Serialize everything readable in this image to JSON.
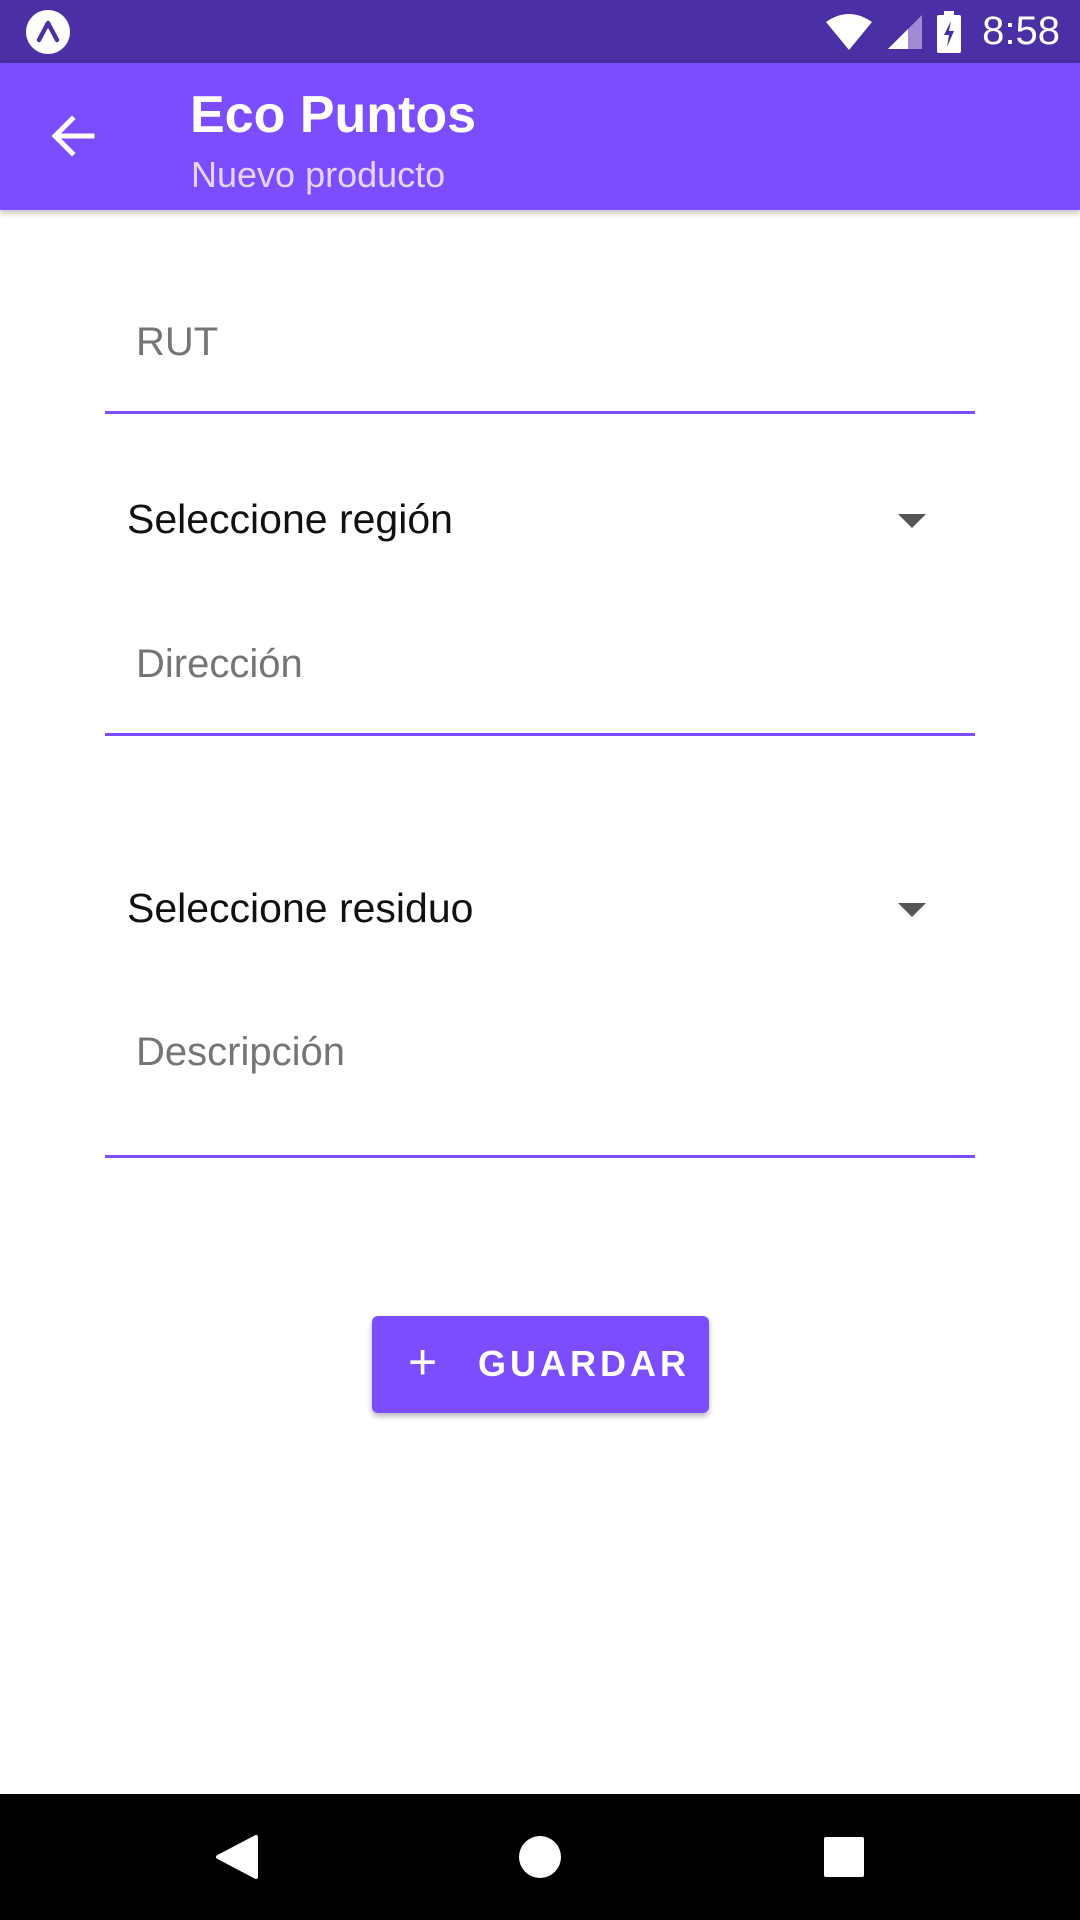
{
  "status_bar": {
    "time": "8:58",
    "app_icon": "expo-icon",
    "wifi_icon": "wifi-icon",
    "signal_icon": "cell-signal-icon",
    "battery_icon": "battery-charging-icon"
  },
  "app_bar": {
    "title": "Eco Puntos",
    "subtitle": "Nuevo producto",
    "back_icon": "arrow-back-icon",
    "color": "#7c4dff"
  },
  "form": {
    "rut": {
      "placeholder": "RUT",
      "value": ""
    },
    "region": {
      "selected": "Seleccione región"
    },
    "direccion": {
      "placeholder": "Dirección",
      "value": ""
    },
    "residuo": {
      "selected": "Seleccione residuo"
    },
    "descripcion": {
      "placeholder": "Descripción",
      "value": ""
    },
    "save_button": {
      "icon": "+",
      "label": "GUARDAR"
    }
  },
  "nav_bar": {
    "back": "nav-back-icon",
    "home": "nav-home-icon",
    "recent": "nav-recents-icon"
  }
}
